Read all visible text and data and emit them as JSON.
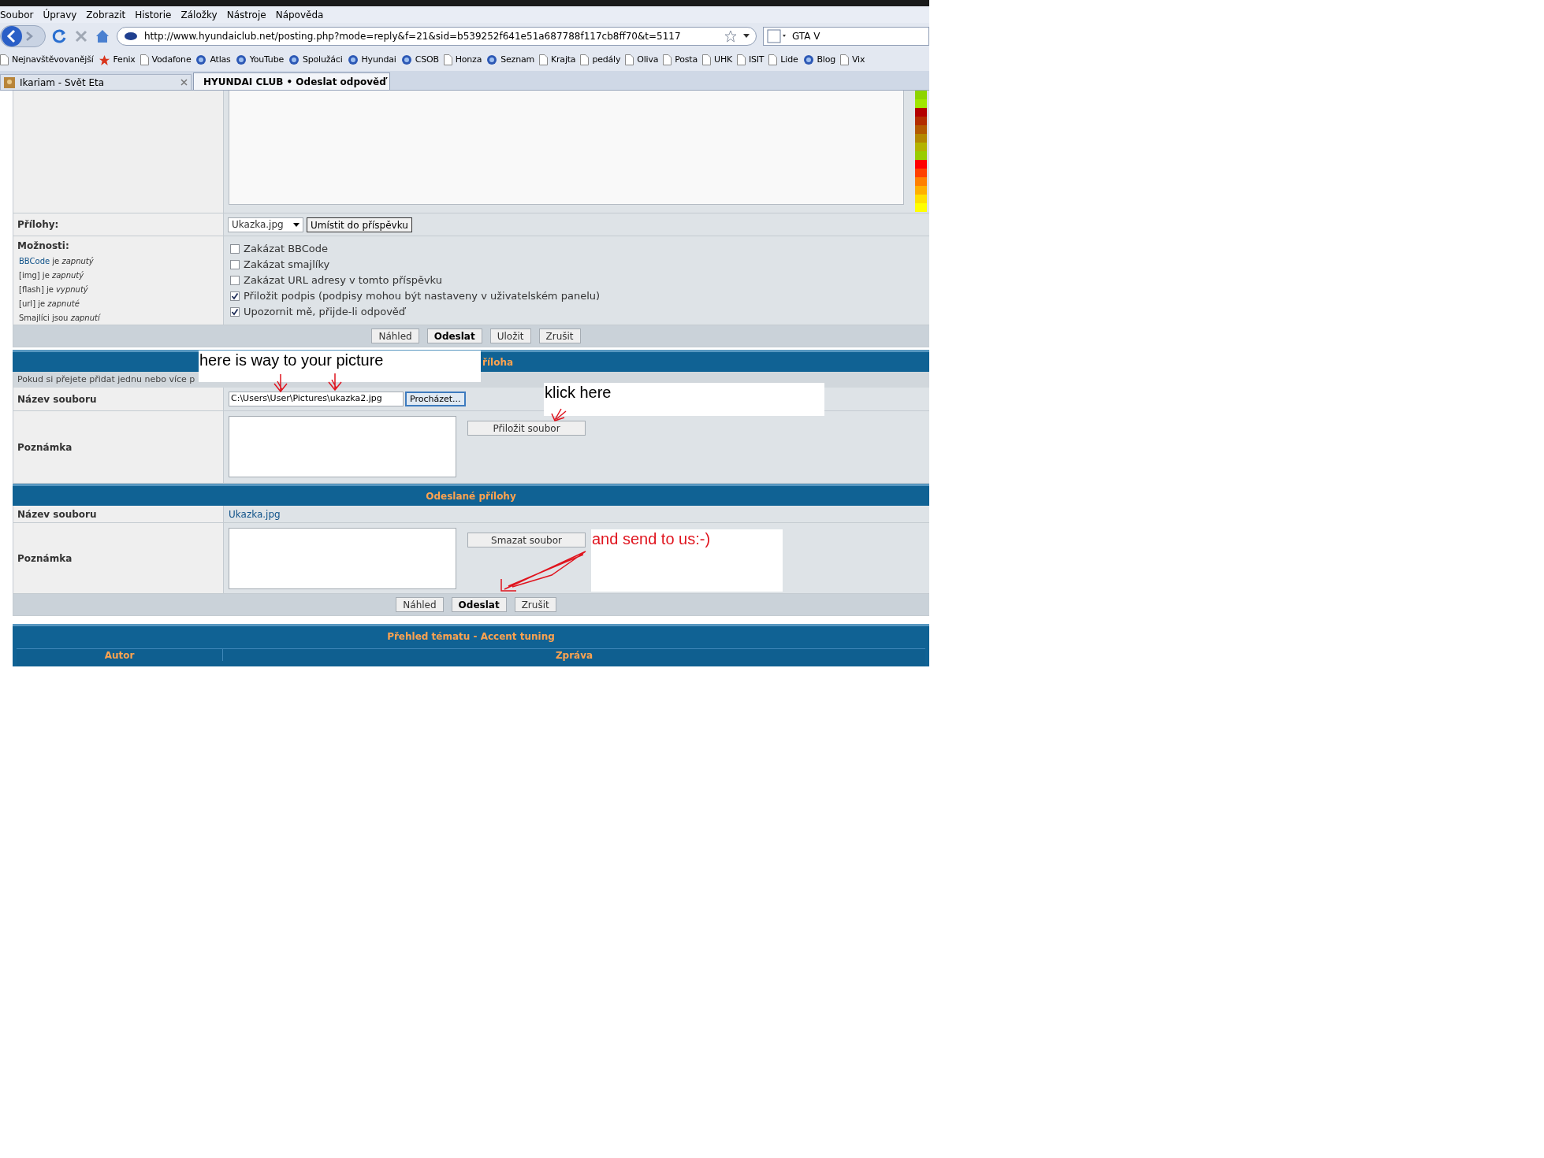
{
  "menu": [
    "Soubor",
    "Úpravy",
    "Zobrazit",
    "Historie",
    "Záložky",
    "Nástroje",
    "Nápověda"
  ],
  "nav": {
    "url": "http://www.hyundaiclub.net/posting.php?mode=reply&f=21&sid=b539252f641e51a687788f117cb8ff70&t=5117",
    "search": "GTA V"
  },
  "bookmarks": [
    {
      "label": "Nejnavštěvovanější",
      "kind": "page"
    },
    {
      "label": "Fenix",
      "kind": "star"
    },
    {
      "label": "Vodafone",
      "kind": "page"
    },
    {
      "label": "Atlas",
      "kind": "logo"
    },
    {
      "label": "YouTube",
      "kind": "logo"
    },
    {
      "label": "Spolužáci",
      "kind": "logo"
    },
    {
      "label": "Hyundai",
      "kind": "logo"
    },
    {
      "label": "CSOB",
      "kind": "logo"
    },
    {
      "label": "Honza",
      "kind": "page"
    },
    {
      "label": "Seznam",
      "kind": "logo"
    },
    {
      "label": "Krajta",
      "kind": "page"
    },
    {
      "label": "pedály",
      "kind": "page"
    },
    {
      "label": "Oliva",
      "kind": "page"
    },
    {
      "label": "Posta",
      "kind": "page"
    },
    {
      "label": "UHK",
      "kind": "page"
    },
    {
      "label": "ISIT",
      "kind": "page"
    },
    {
      "label": "Lide",
      "kind": "page"
    },
    {
      "label": "Blog",
      "kind": "logo"
    },
    {
      "label": "Vix",
      "kind": "page"
    }
  ],
  "tabs": [
    {
      "label": "Ikariam - Svět Eta",
      "selected": false
    },
    {
      "label": "HYUNDAI CLUB • Odeslat odpověď",
      "selected": true
    }
  ],
  "post": {
    "attachments_label": "Přílohy:",
    "attachment_select": "Ukazka.jpg",
    "place_button": "Umístit do příspěvku",
    "options_title": "Možnosti:",
    "option_notes": [
      {
        "link": "BBCode",
        "text": "je *zapnutý*"
      },
      {
        "text": "[img] je *zapnutý*"
      },
      {
        "text": "[flash] je *vypnutý*"
      },
      {
        "text": "[url] je *zapnuté*"
      },
      {
        "text": "Smajlíci jsou *zapnutí*"
      }
    ],
    "options": [
      {
        "label": "Zakázat BBCode",
        "checked": false
      },
      {
        "label": "Zakázat smajlíky",
        "checked": false
      },
      {
        "label": "Zakázat URL adresy v tomto příspěvku",
        "checked": false
      },
      {
        "label": "Přiložit podpis (podpisy mohou být nastaveny v uživatelském panelu)",
        "checked": true
      },
      {
        "label": "Upozornit mě, přijde-li odpověď",
        "checked": true
      }
    ],
    "buttons": [
      {
        "label": "Náhled",
        "primary": false
      },
      {
        "label": "Odeslat",
        "primary": true
      },
      {
        "label": "Uložit",
        "primary": false
      },
      {
        "label": "Zrušit",
        "primary": false
      }
    ]
  },
  "upload": {
    "header": "říloha",
    "info": "Pokud si přejete přidat jednu nebo více p",
    "file_label": "Název souboru",
    "file_value": "C:\\Users\\User\\Pictures\\ukazka2.jpg",
    "browse_button": "Procházet...",
    "note_label": "Poznámka",
    "attach_button": "Přiložit soubor"
  },
  "sent": {
    "header": "Odeslané přílohy",
    "file_label": "Název souboru",
    "file_link": "Ukazka.jpg",
    "note_label": "Poznámka",
    "delete_button": "Smazat soubor",
    "buttons": [
      {
        "label": "Náhled",
        "primary": false
      },
      {
        "label": "Odeslat",
        "primary": true
      },
      {
        "label": "Zrušit",
        "primary": false
      }
    ]
  },
  "review": {
    "header": "Přehled tématu - Accent tuning",
    "columns": [
      "Autor",
      "Zpráva"
    ]
  },
  "annotations": [
    {
      "text": "here is way to your picture",
      "color": "#000000"
    },
    {
      "text": "klick here",
      "color": "#000000"
    },
    {
      "text": "and send to us:-)",
      "color": "#e0141e"
    }
  ]
}
